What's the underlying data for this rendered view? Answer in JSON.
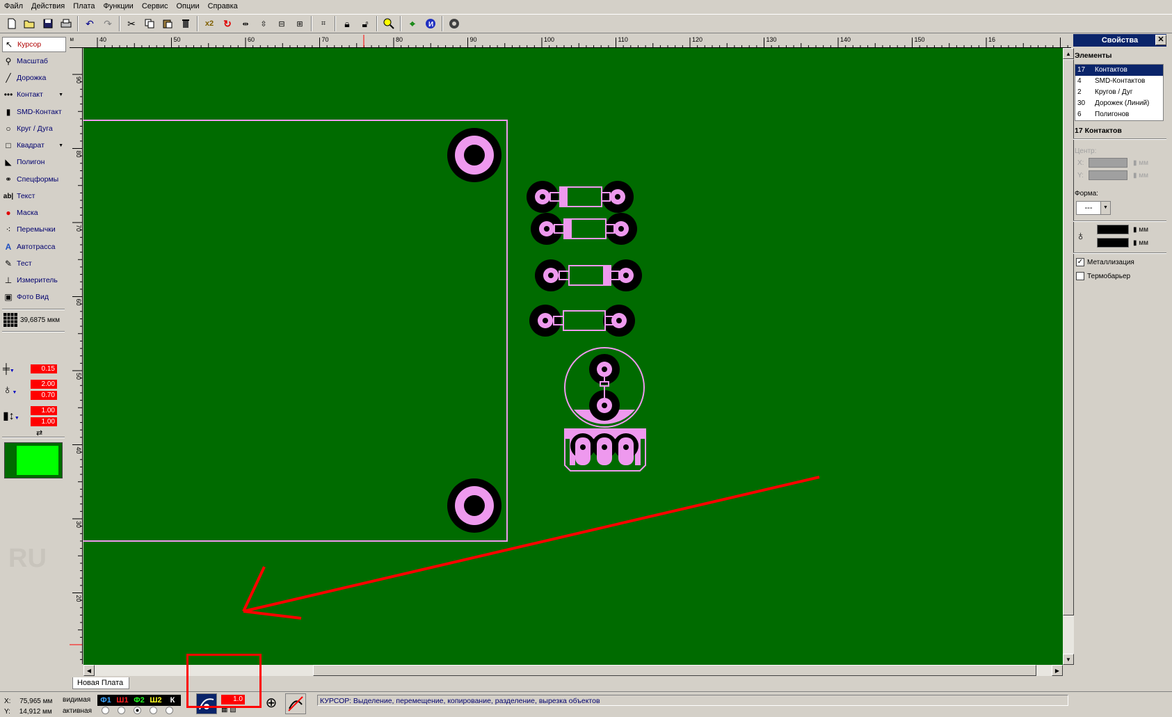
{
  "menu": [
    "Файл",
    "Действия",
    "Плата",
    "Функции",
    "Сервис",
    "Опции",
    "Справка"
  ],
  "toolbar": {
    "icons": [
      "new-icon",
      "open-icon",
      "save-icon",
      "print-icon",
      "undo-icon",
      "redo-icon",
      "cut-icon",
      "copy-icon",
      "paste-icon",
      "delete-icon",
      "scale-x2-icon",
      "rotate-icon",
      "mirror-h-icon",
      "mirror-v-icon",
      "align-icon",
      "group-icon",
      "snap-icon",
      "lock-icon",
      "unlock-icon",
      "zoom-icon",
      "crop-icon",
      "info-icon",
      "grid-icon"
    ],
    "x2_label": "x2"
  },
  "tools": [
    {
      "label": "Курсор",
      "icon": "cursor-icon"
    },
    {
      "label": "Масштаб",
      "icon": "zoom-icon"
    },
    {
      "label": "Дорожка",
      "icon": "track-icon"
    },
    {
      "label": "Контакт",
      "icon": "pad-icon"
    },
    {
      "label": "SMD-Контакт",
      "icon": "smd-icon"
    },
    {
      "label": "Круг / Дуга",
      "icon": "circle-icon"
    },
    {
      "label": "Квадрат",
      "icon": "square-icon"
    },
    {
      "label": "Полигон",
      "icon": "polygon-icon"
    },
    {
      "label": "Спецформы",
      "icon": "special-shapes-icon"
    },
    {
      "label": "Текст",
      "icon": "text-icon"
    },
    {
      "label": "Маска",
      "icon": "mask-icon"
    },
    {
      "label": "Перемычки",
      "icon": "jumper-icon"
    },
    {
      "label": "Автотрасса",
      "icon": "autoroute-icon"
    },
    {
      "label": "Тест",
      "icon": "test-icon"
    },
    {
      "label": "Измеритель",
      "icon": "measure-icon"
    },
    {
      "label": "Фото Вид",
      "icon": "photo-view-icon"
    }
  ],
  "grid": {
    "value": "39,6875 мкм"
  },
  "params": {
    "track_width": "0.15",
    "pad_outer": "2.00",
    "pad_inner": "0.70",
    "smd_w": "1.00",
    "smd_h": "1.00"
  },
  "watermark": "RU",
  "ruler": {
    "unit": "мм",
    "top_labels": [
      "40",
      "50",
      "60",
      "70",
      "80",
      "90",
      "100",
      "110",
      "120",
      "130",
      "140",
      "150",
      "16"
    ],
    "left_labels": [
      "90",
      "80",
      "70",
      "60",
      "50",
      "40",
      "30",
      "20"
    ]
  },
  "board_tab": "Новая Плата",
  "status": {
    "x_label": "X:",
    "x_value": "75,965 мм",
    "y_label": "Y:",
    "y_value": "14,912 мм",
    "visible_label": "видимая",
    "active_label": "активная",
    "layers": [
      {
        "name": "Ф1",
        "color": "#3da5ff"
      },
      {
        "name": "Ш1",
        "color": "#ff2020"
      },
      {
        "name": "Ф2",
        "color": "#20ff20"
      },
      {
        "name": "Ш2",
        "color": "#ffff20"
      },
      {
        "name": "К",
        "color": "#ffffff"
      }
    ],
    "grid_step": "1.0",
    "message": "КУРСОР: Выделение, перемещение, копирование, разделение, вырезка объектов"
  },
  "properties": {
    "title": "Свойства",
    "elements_header": "Элементы",
    "elements": [
      {
        "count": "17",
        "name": "Контактов",
        "selected": true
      },
      {
        "count": "4",
        "name": "SMD-Контактов",
        "selected": false
      },
      {
        "count": "2",
        "name": "Кругов / Дуг",
        "selected": false
      },
      {
        "count": "30",
        "name": "Дорожек (Линий)",
        "selected": false
      },
      {
        "count": "6",
        "name": "Полигонов",
        "selected": false
      }
    ],
    "selection_header": "17 Контактов",
    "center_label": "Центр:",
    "x_label": "X:",
    "y_label": "Y:",
    "unit": "мм",
    "shape_label": "Форма:",
    "shape_value": "---",
    "metallization_label": "Металлизация",
    "metallization_checked": true,
    "thermal_label": "Термобарьер",
    "thermal_checked": false
  },
  "colors": {
    "board": "#006b00",
    "copper_pad": "#ee99ee",
    "annotation": "#ff0000",
    "active_layer": "#00ff00"
  }
}
